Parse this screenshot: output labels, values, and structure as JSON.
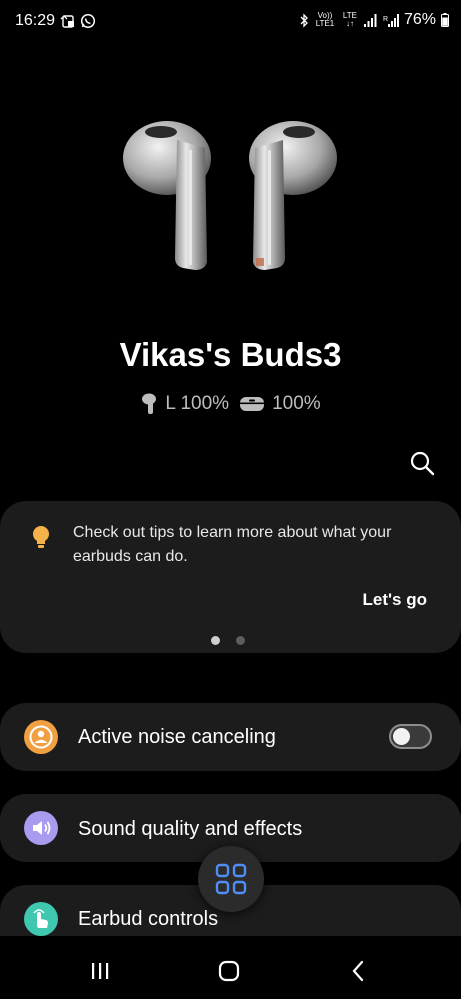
{
  "status_bar": {
    "time": "16:29",
    "volte_label": "Vo)) LTE1",
    "lte_label": "LTE",
    "battery": "76%"
  },
  "device": {
    "name": "Vikas's Buds3",
    "left_bud": "L 100%",
    "case": "100%"
  },
  "tips": {
    "text": "Check out tips to learn more about what your earbuds can do.",
    "action": "Let's go",
    "page_count": 2,
    "active_page": 1
  },
  "settings": {
    "anc_label": "Active noise canceling",
    "anc_enabled": false,
    "sound_label": "Sound quality and effects",
    "controls_label": "Earbud controls"
  },
  "colors": {
    "anc_icon": "#f0a040",
    "sound_icon": "#a99bef",
    "controls_icon": "#3fc7b0",
    "fab_icon": "#4f8ef7",
    "tip_bulb": "#f6b24a"
  },
  "icons": {
    "search": "search-icon",
    "anc": "person-noise-icon",
    "sound": "speaker-icon",
    "controls": "touch-hand-icon",
    "fab": "apps-grid-icon",
    "nav_recents": "recents-icon",
    "nav_home": "home-icon",
    "nav_back": "back-icon"
  }
}
